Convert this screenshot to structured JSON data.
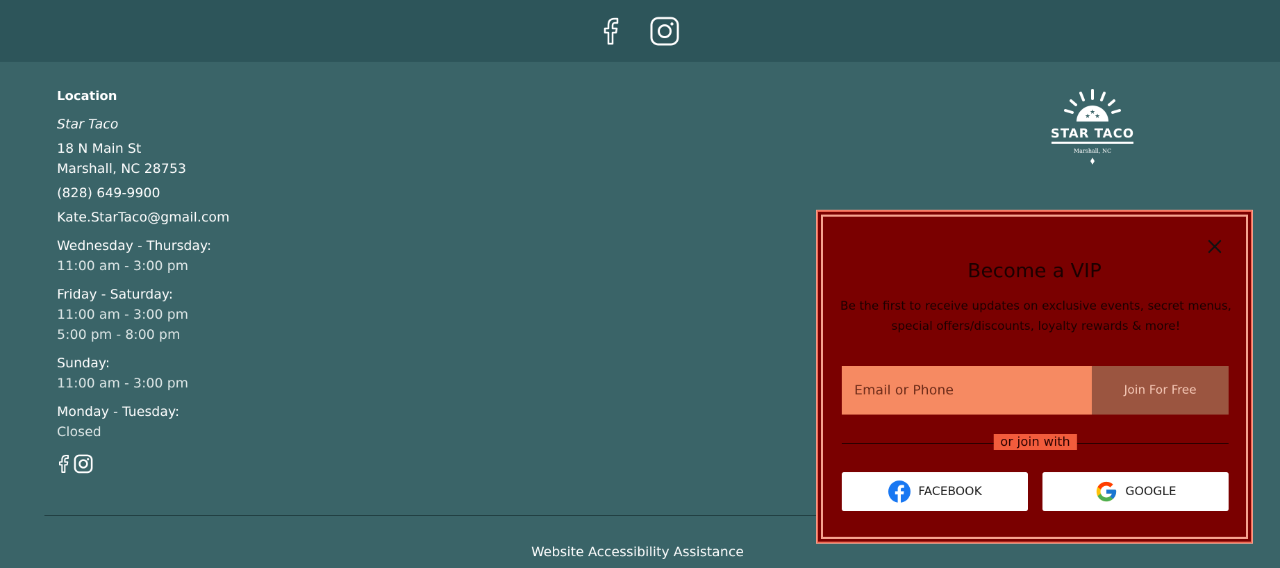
{
  "topbar": {
    "icons": [
      "facebook-icon",
      "instagram-icon"
    ]
  },
  "location": {
    "heading": "Location",
    "name": "Star Taco",
    "address_line1": "18 N Main St",
    "address_line2": "Marshall, NC 28753",
    "phone": "(828) 649-9900",
    "email": "Kate.StarTaco@gmail.com",
    "hours": [
      {
        "days": "Wednesday - Thursday:",
        "times": [
          "11:00 am - 3:00 pm"
        ]
      },
      {
        "days": "Friday - Saturday:",
        "times": [
          "11:00 am - 3:00 pm",
          "5:00 pm - 8:00 pm"
        ]
      },
      {
        "days": "Sunday:",
        "times": [
          "11:00 am - 3:00 pm"
        ]
      },
      {
        "days": "Monday - Tuesday:",
        "times": [
          "Closed"
        ]
      }
    ]
  },
  "logo": {
    "name": "STAR TACO",
    "location": "Marshall, NC"
  },
  "footer": {
    "accessibility": "Website Accessibility Assistance"
  },
  "popup": {
    "title": "Become a VIP",
    "description": "Be the first to receive updates on exclusive events, secret menus, special offers/discounts, loyalty rewards & more!",
    "input_placeholder": "Email or Phone",
    "join_button": "Join For Free",
    "or_label": "or join with",
    "facebook_button": "FACEBOOK",
    "google_button": "GOOGLE"
  },
  "colors": {
    "page_bg": "#3a6468",
    "topbar_bg": "#2d555a",
    "popup_bg": "#7a0000",
    "popup_border": "#f26a55",
    "input_bg": "#f68a62",
    "join_bg": "#9b5540"
  }
}
